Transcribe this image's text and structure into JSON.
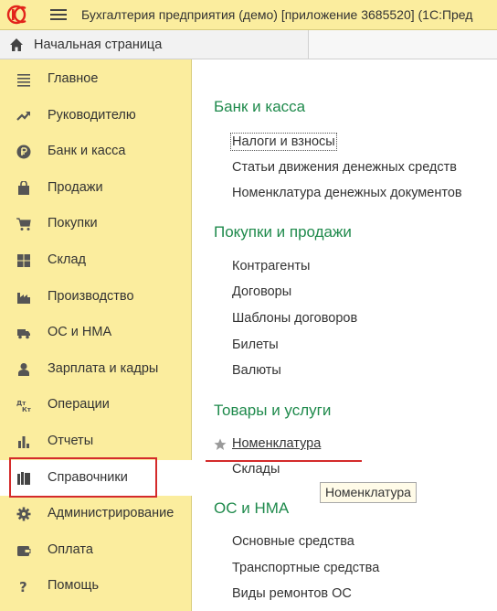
{
  "titlebar": {
    "logo_text": "1С",
    "title": "Бухгалтерия предприятия (демо) [приложение 3685520]  (1С:Пред"
  },
  "home": {
    "label": "Начальная страница"
  },
  "sidebar": {
    "items": [
      {
        "label": "Главное",
        "icon": "menu-lines-icon"
      },
      {
        "label": "Руководителю",
        "icon": "trend-up-icon"
      },
      {
        "label": "Банк и касса",
        "icon": "ruble-coin-icon"
      },
      {
        "label": "Продажи",
        "icon": "shopping-bag-icon"
      },
      {
        "label": "Покупки",
        "icon": "cart-icon"
      },
      {
        "label": "Склад",
        "icon": "warehouse-grid-icon"
      },
      {
        "label": "Производство",
        "icon": "factory-icon"
      },
      {
        "label": "ОС и НМА",
        "icon": "truck-icon"
      },
      {
        "label": "Зарплата и кадры",
        "icon": "person-icon"
      },
      {
        "label": "Операции",
        "icon": "dt-kt-icon"
      },
      {
        "label": "Отчеты",
        "icon": "bar-chart-icon"
      },
      {
        "label": "Справочники",
        "icon": "books-icon",
        "active": true
      },
      {
        "label": "Администрирование",
        "icon": "gear-icon"
      },
      {
        "label": "Оплата",
        "icon": "wallet-icon"
      },
      {
        "label": "Помощь",
        "icon": "question-icon"
      }
    ]
  },
  "main": {
    "sections": [
      {
        "title": "Банк и касса",
        "links": [
          "Налоги и взносы",
          "Статьи движения денежных средств",
          "Номенклатура денежных документов"
        ]
      },
      {
        "title": "Покупки и продажи",
        "links": [
          "Контрагенты",
          "Договоры",
          "Шаблоны договоров",
          "Билеты",
          "Валюты"
        ]
      },
      {
        "title": "Товары и услуги",
        "links": [
          "Номенклатура",
          "Склады"
        ]
      },
      {
        "title": "ОС и НМА",
        "links": [
          "Основные средства",
          "Транспортные средства",
          "Виды ремонтов ОС"
        ]
      }
    ],
    "tooltip": "Номенклатура"
  },
  "colors": {
    "sidebar_bg": "#fbed9e",
    "section_title": "#1f8a4c",
    "highlight_red": "#d42b2b"
  }
}
